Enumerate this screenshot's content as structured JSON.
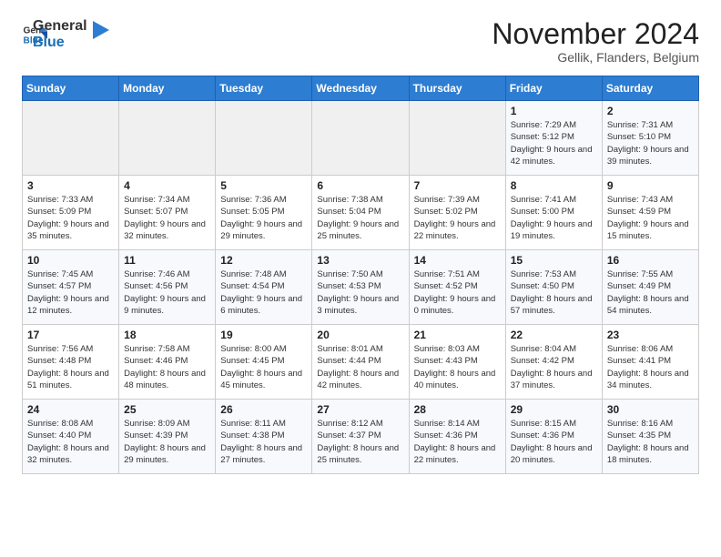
{
  "logo": {
    "line1": "General",
    "line2": "Blue"
  },
  "title": "November 2024",
  "location": "Gellik, Flanders, Belgium",
  "days_of_week": [
    "Sunday",
    "Monday",
    "Tuesday",
    "Wednesday",
    "Thursday",
    "Friday",
    "Saturday"
  ],
  "weeks": [
    [
      {
        "day": "",
        "info": ""
      },
      {
        "day": "",
        "info": ""
      },
      {
        "day": "",
        "info": ""
      },
      {
        "day": "",
        "info": ""
      },
      {
        "day": "",
        "info": ""
      },
      {
        "day": "1",
        "info": "Sunrise: 7:29 AM\nSunset: 5:12 PM\nDaylight: 9 hours\nand 42 minutes."
      },
      {
        "day": "2",
        "info": "Sunrise: 7:31 AM\nSunset: 5:10 PM\nDaylight: 9 hours\nand 39 minutes."
      }
    ],
    [
      {
        "day": "3",
        "info": "Sunrise: 7:33 AM\nSunset: 5:09 PM\nDaylight: 9 hours\nand 35 minutes."
      },
      {
        "day": "4",
        "info": "Sunrise: 7:34 AM\nSunset: 5:07 PM\nDaylight: 9 hours\nand 32 minutes."
      },
      {
        "day": "5",
        "info": "Sunrise: 7:36 AM\nSunset: 5:05 PM\nDaylight: 9 hours\nand 29 minutes."
      },
      {
        "day": "6",
        "info": "Sunrise: 7:38 AM\nSunset: 5:04 PM\nDaylight: 9 hours\nand 25 minutes."
      },
      {
        "day": "7",
        "info": "Sunrise: 7:39 AM\nSunset: 5:02 PM\nDaylight: 9 hours\nand 22 minutes."
      },
      {
        "day": "8",
        "info": "Sunrise: 7:41 AM\nSunset: 5:00 PM\nDaylight: 9 hours\nand 19 minutes."
      },
      {
        "day": "9",
        "info": "Sunrise: 7:43 AM\nSunset: 4:59 PM\nDaylight: 9 hours\nand 15 minutes."
      }
    ],
    [
      {
        "day": "10",
        "info": "Sunrise: 7:45 AM\nSunset: 4:57 PM\nDaylight: 9 hours\nand 12 minutes."
      },
      {
        "day": "11",
        "info": "Sunrise: 7:46 AM\nSunset: 4:56 PM\nDaylight: 9 hours\nand 9 minutes."
      },
      {
        "day": "12",
        "info": "Sunrise: 7:48 AM\nSunset: 4:54 PM\nDaylight: 9 hours\nand 6 minutes."
      },
      {
        "day": "13",
        "info": "Sunrise: 7:50 AM\nSunset: 4:53 PM\nDaylight: 9 hours\nand 3 minutes."
      },
      {
        "day": "14",
        "info": "Sunrise: 7:51 AM\nSunset: 4:52 PM\nDaylight: 9 hours\nand 0 minutes."
      },
      {
        "day": "15",
        "info": "Sunrise: 7:53 AM\nSunset: 4:50 PM\nDaylight: 8 hours\nand 57 minutes."
      },
      {
        "day": "16",
        "info": "Sunrise: 7:55 AM\nSunset: 4:49 PM\nDaylight: 8 hours\nand 54 minutes."
      }
    ],
    [
      {
        "day": "17",
        "info": "Sunrise: 7:56 AM\nSunset: 4:48 PM\nDaylight: 8 hours\nand 51 minutes."
      },
      {
        "day": "18",
        "info": "Sunrise: 7:58 AM\nSunset: 4:46 PM\nDaylight: 8 hours\nand 48 minutes."
      },
      {
        "day": "19",
        "info": "Sunrise: 8:00 AM\nSunset: 4:45 PM\nDaylight: 8 hours\nand 45 minutes."
      },
      {
        "day": "20",
        "info": "Sunrise: 8:01 AM\nSunset: 4:44 PM\nDaylight: 8 hours\nand 42 minutes."
      },
      {
        "day": "21",
        "info": "Sunrise: 8:03 AM\nSunset: 4:43 PM\nDaylight: 8 hours\nand 40 minutes."
      },
      {
        "day": "22",
        "info": "Sunrise: 8:04 AM\nSunset: 4:42 PM\nDaylight: 8 hours\nand 37 minutes."
      },
      {
        "day": "23",
        "info": "Sunrise: 8:06 AM\nSunset: 4:41 PM\nDaylight: 8 hours\nand 34 minutes."
      }
    ],
    [
      {
        "day": "24",
        "info": "Sunrise: 8:08 AM\nSunset: 4:40 PM\nDaylight: 8 hours\nand 32 minutes."
      },
      {
        "day": "25",
        "info": "Sunrise: 8:09 AM\nSunset: 4:39 PM\nDaylight: 8 hours\nand 29 minutes."
      },
      {
        "day": "26",
        "info": "Sunrise: 8:11 AM\nSunset: 4:38 PM\nDaylight: 8 hours\nand 27 minutes."
      },
      {
        "day": "27",
        "info": "Sunrise: 8:12 AM\nSunset: 4:37 PM\nDaylight: 8 hours\nand 25 minutes."
      },
      {
        "day": "28",
        "info": "Sunrise: 8:14 AM\nSunset: 4:36 PM\nDaylight: 8 hours\nand 22 minutes."
      },
      {
        "day": "29",
        "info": "Sunrise: 8:15 AM\nSunset: 4:36 PM\nDaylight: 8 hours\nand 20 minutes."
      },
      {
        "day": "30",
        "info": "Sunrise: 8:16 AM\nSunset: 4:35 PM\nDaylight: 8 hours\nand 18 minutes."
      }
    ]
  ]
}
